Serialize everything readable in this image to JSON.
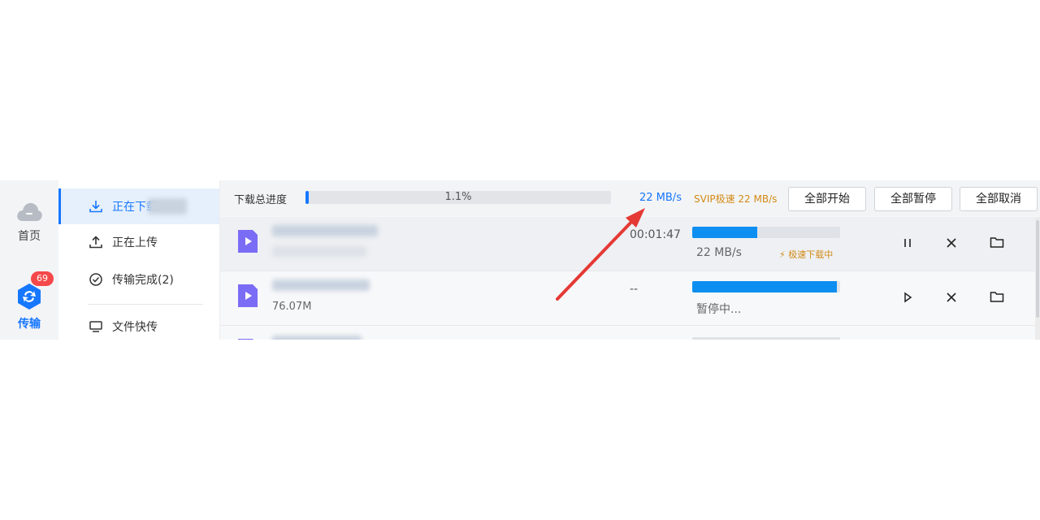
{
  "rail": {
    "home_label": "首页",
    "transfer_label": "传输",
    "badge_count": "69"
  },
  "sidebar": {
    "items": [
      {
        "label": "正在下载",
        "icon": "download-icon"
      },
      {
        "label": "正在上传",
        "icon": "upload-icon"
      },
      {
        "label": "传输完成(2)",
        "icon": "check-circle-icon"
      },
      {
        "label": "文件快传",
        "icon": "monitor-icon"
      }
    ]
  },
  "topbar": {
    "progress_label": "下载总进度",
    "progress_pct": "1.1%",
    "progress_value": 0.011,
    "speed": "22 MB/s",
    "svip": "SVIP极速 22 MB/s",
    "start_all": "全部开始",
    "pause_all": "全部暂停",
    "cancel_all": "全部取消"
  },
  "rows": [
    {
      "size": "",
      "time": "00:01:47",
      "speed": "22 MB/s",
      "status": "极速下载中",
      "progress": 0.44
    },
    {
      "size": "76.07M",
      "time": "--",
      "speed": "暂停中...",
      "status": "",
      "progress": 0.98
    }
  ],
  "colors": {
    "accent": "#1677ff",
    "svip": "#d28a14",
    "badge": "#f5484a",
    "arrow": "#e53935"
  }
}
